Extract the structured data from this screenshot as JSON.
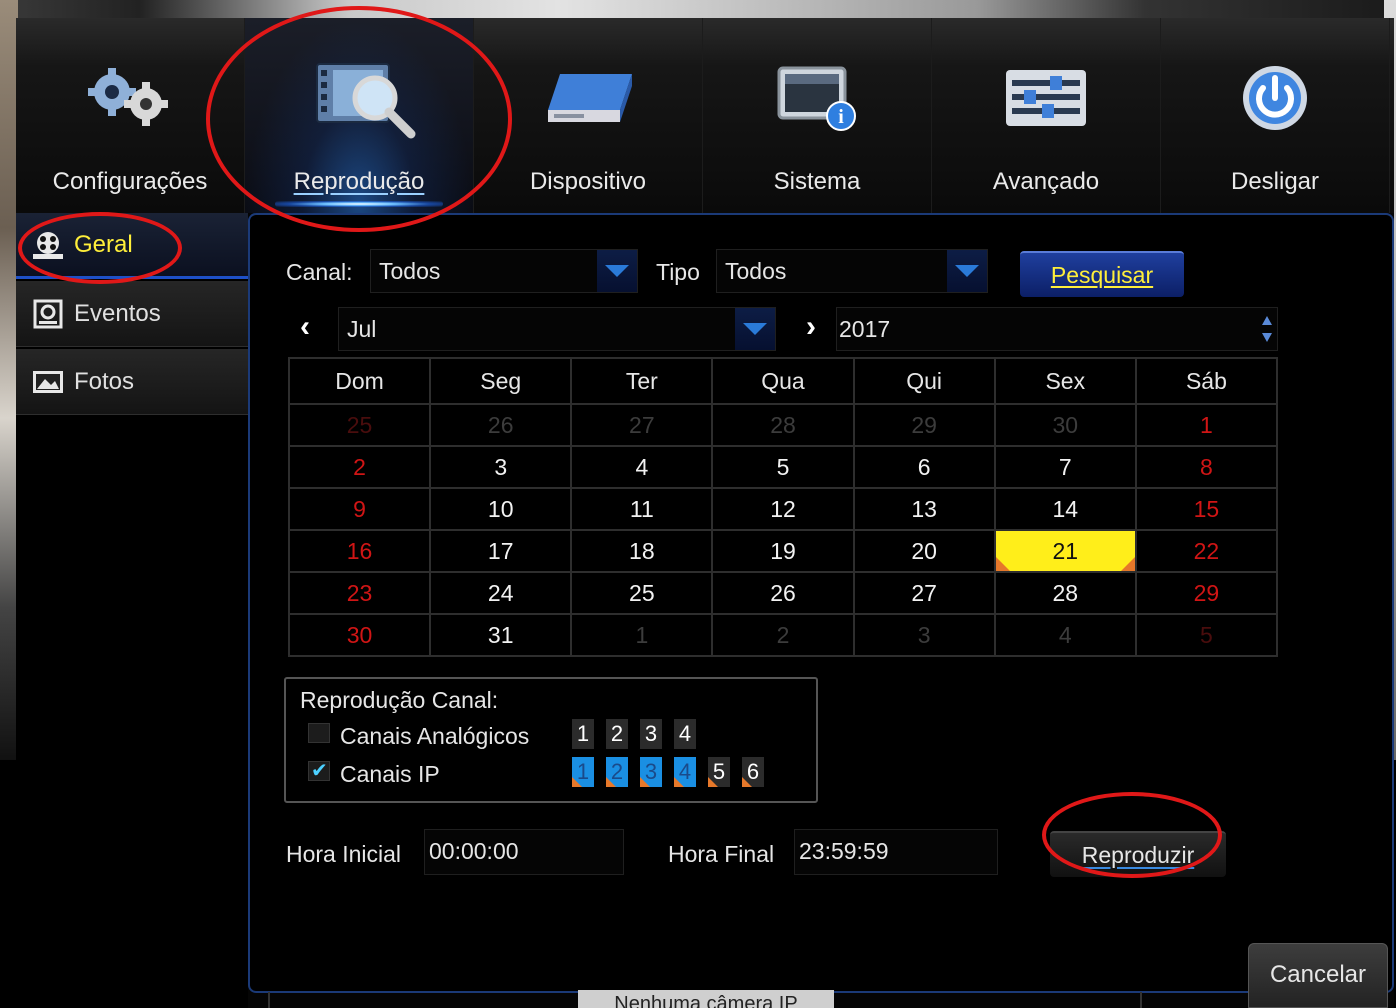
{
  "nav": {
    "items": [
      {
        "label": "Configurações",
        "icon": "gears-icon"
      },
      {
        "label": "Reprodução",
        "icon": "playback-search-icon",
        "active": true
      },
      {
        "label": "Dispositivo",
        "icon": "hard-drive-icon"
      },
      {
        "label": "Sistema",
        "icon": "system-info-icon"
      },
      {
        "label": "Avançado",
        "icon": "advanced-sliders-icon"
      },
      {
        "label": "Desligar",
        "icon": "power-icon"
      }
    ]
  },
  "sidebar": {
    "items": [
      {
        "label": "Geral",
        "icon": "film-reel-icon",
        "active": true
      },
      {
        "label": "Eventos",
        "icon": "event-film-icon"
      },
      {
        "label": "Fotos",
        "icon": "photo-icon"
      }
    ]
  },
  "search": {
    "canal_label": "Canal:",
    "canal_value": "Todos",
    "tipo_label": "Tipo",
    "tipo_value": "Todos",
    "button": "Pesquisar"
  },
  "month_nav": {
    "month": "Jul",
    "year": "2017"
  },
  "calendar": {
    "headers": [
      "Dom",
      "Seg",
      "Ter",
      "Qua",
      "Qui",
      "Sex",
      "Sáb"
    ],
    "selected": "21",
    "weeks": [
      [
        "25",
        "26",
        "27",
        "28",
        "29",
        "30",
        "1"
      ],
      [
        "2",
        "3",
        "4",
        "5",
        "6",
        "7",
        "8"
      ],
      [
        "9",
        "10",
        "11",
        "12",
        "13",
        "14",
        "15"
      ],
      [
        "16",
        "17",
        "18",
        "19",
        "20",
        "21",
        "22"
      ],
      [
        "23",
        "24",
        "25",
        "26",
        "27",
        "28",
        "29"
      ],
      [
        "30",
        "31",
        "1",
        "2",
        "3",
        "4",
        "5"
      ]
    ]
  },
  "channels": {
    "title": "Reprodução Canal:",
    "analog_label": "Canais Analógicos",
    "analog_checked": false,
    "analog_channels": [
      "1",
      "2",
      "3",
      "4"
    ],
    "ip_label": "Canais IP",
    "ip_checked": true,
    "ip_channels": [
      "1",
      "2",
      "3",
      "4",
      "5",
      "6"
    ]
  },
  "time": {
    "start_label": "Hora Inicial",
    "start_value": "00:00:00",
    "end_label": "Hora Final",
    "end_value": "23:59:59"
  },
  "buttons": {
    "play": "Reproduzir",
    "cancel": "Cancelar"
  },
  "status": {
    "text": "Nenhuma câmera IP"
  },
  "colors": {
    "accent": "#ffef3a",
    "weekend": "#d01515",
    "selected_day": "#ffee1a",
    "record_flag": "#e6782a",
    "ip_channel": "#1a8fe3"
  }
}
